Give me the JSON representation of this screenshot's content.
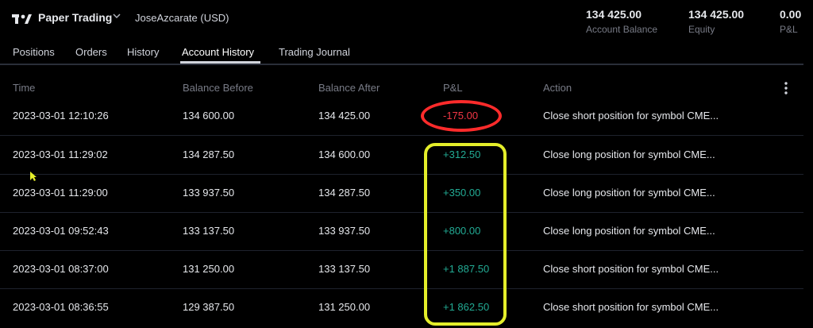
{
  "header": {
    "brand": "Paper Trading",
    "account": "JoseAzcarate (USD)",
    "stats": [
      {
        "value": "134 425.00",
        "label": "Account Balance"
      },
      {
        "value": "134 425.00",
        "label": "Equity"
      },
      {
        "value": "0.00",
        "label": "P&L"
      }
    ]
  },
  "tabs": [
    {
      "label": "Positions"
    },
    {
      "label": "Orders"
    },
    {
      "label": "History"
    },
    {
      "label": "Account History",
      "active": true
    },
    {
      "label": "Trading Journal"
    }
  ],
  "table": {
    "columns": [
      "Time",
      "Balance Before",
      "Balance After",
      "P&L",
      "Action"
    ],
    "rows": [
      {
        "time": "2023-03-01 12:10:26",
        "before": "134 600.00",
        "after": "134 425.00",
        "pnl": "-175.00",
        "action": "Close short position for symbol CME..."
      },
      {
        "time": "2023-03-01 11:29:02",
        "before": "134 287.50",
        "after": "134 600.00",
        "pnl": "+312.50",
        "action": "Close long position for symbol CME..."
      },
      {
        "time": "2023-03-01 11:29:00",
        "before": "133 937.50",
        "after": "134 287.50",
        "pnl": "+350.00",
        "action": "Close long position for symbol CME..."
      },
      {
        "time": "2023-03-01 09:52:43",
        "before": "133 137.50",
        "after": "133 937.50",
        "pnl": "+800.00",
        "action": "Close long position for symbol CME..."
      },
      {
        "time": "2023-03-01 08:37:00",
        "before": "131 250.00",
        "after": "133 137.50",
        "pnl": "+1 887.50",
        "action": "Close short position for symbol CME..."
      },
      {
        "time": "2023-03-01 08:36:55",
        "before": "129 387.50",
        "after": "131 250.00",
        "pnl": "+1 862.50",
        "action": "Close short position for symbol CME..."
      }
    ]
  },
  "icons": {
    "logo": "tradingview-logo-icon",
    "brand_menu": "chevron-down-icon",
    "table_menu": "more-vertical-icon"
  },
  "colors": {
    "background": "#000000",
    "negative": "#f23645",
    "positive": "#22ab94",
    "annotation_red": "#ff2b2b",
    "annotation_yellow": "#e4ee2a"
  }
}
